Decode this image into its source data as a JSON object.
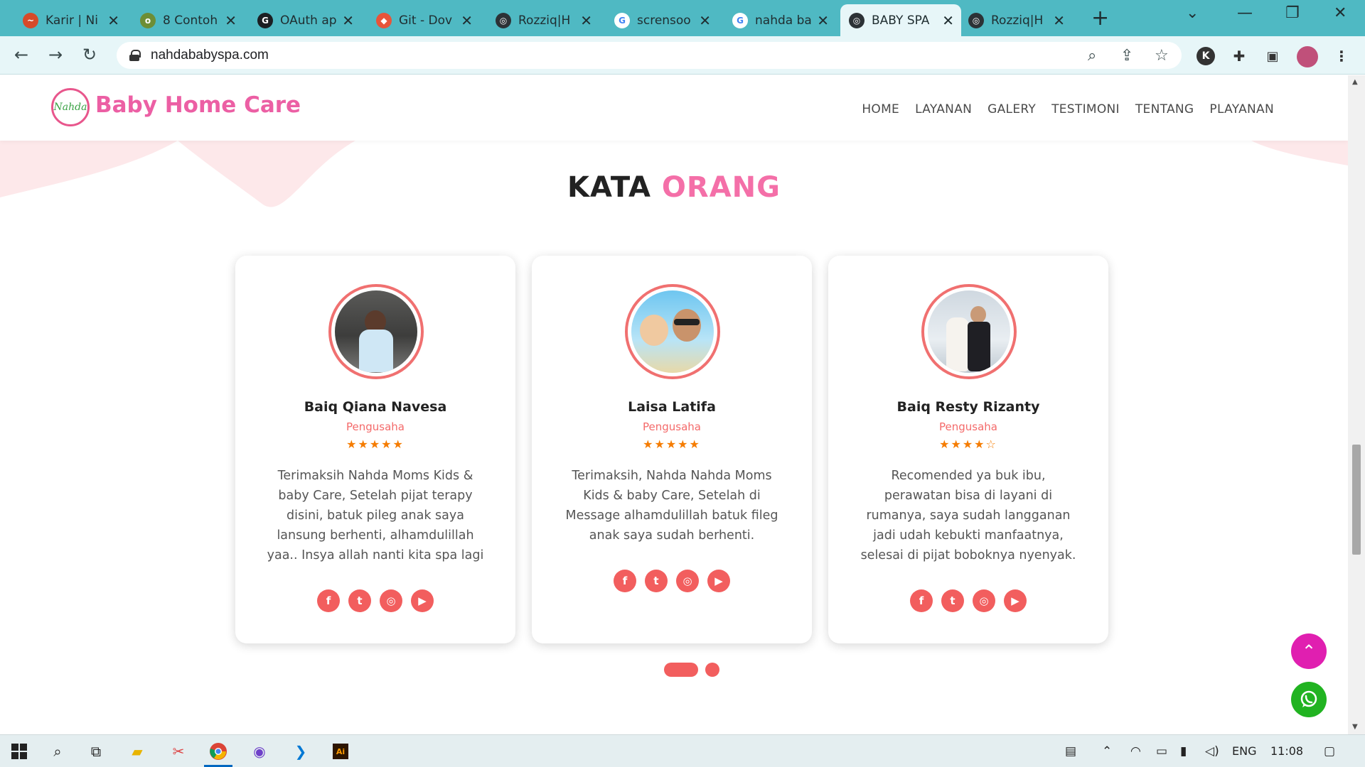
{
  "browser": {
    "tabs": [
      {
        "title": "Karir | Ni",
        "color": "#d64a2a",
        "glyph": "~"
      },
      {
        "title": "8 Contoh",
        "color": "#6d8e36",
        "glyph": "o"
      },
      {
        "title": "OAuth ap",
        "color": "#1b1f23",
        "glyph": "G"
      },
      {
        "title": "Git - Dov",
        "color": "#e8543a",
        "glyph": "◆"
      },
      {
        "title": "Rozziq|H",
        "color": "#2c3236",
        "glyph": "◎"
      },
      {
        "title": "scrensoo",
        "color": "#ffffff",
        "glyph": "G"
      },
      {
        "title": "nahda ba",
        "color": "#ffffff",
        "glyph": "G"
      },
      {
        "title": "BABY SPA",
        "color": "#2c3236",
        "glyph": "◎"
      },
      {
        "title": "Rozziq|H",
        "color": "#2c3236",
        "glyph": "◎"
      }
    ],
    "active_tab_index": 7,
    "url": "nahdababyspa.com"
  },
  "site": {
    "logo_mark": "Nahda",
    "brand": "Baby Home Care",
    "menu": [
      "HOME",
      "LAYANAN",
      "GALERY",
      "TESTIMONI",
      "TENTANG",
      "PLAYANAN"
    ]
  },
  "section": {
    "title_part1": "KATA",
    "title_part2": "ORANG"
  },
  "testimonials": [
    {
      "name": "Baiq Qiana Navesa",
      "role": "Pengusaha",
      "rating": 5,
      "stars": "★★★★★",
      "quote": "Terimaksih Nahda Moms Kids & baby Care, Setelah pijat terapy disini, batuk pileg anak saya lansung berhenti, alhamdulillah yaa.. Insya allah nanti kita spa lagi"
    },
    {
      "name": "Laisa Latifa",
      "role": "Pengusaha",
      "rating": 5,
      "stars": "★★★★★",
      "quote": "Terimaksih, Nahda Nahda Moms Kids & baby Care, Setelah di Message alhamdulillah batuk fileg anak saya sudah berhenti."
    },
    {
      "name": "Baiq Resty Rizanty",
      "role": "Pengusaha",
      "rating": 4,
      "stars": "★★★★☆",
      "quote": "Recomended ya buk ibu, perawatan bisa di layani di rumanya, saya sudah langganan jadi udah kebukti manfaatnya, selesai di pijat boboknya nyenyak."
    }
  ],
  "social_icons": [
    "facebook-icon",
    "twitter-icon",
    "instagram-icon",
    "youtube-icon"
  ],
  "carousel": {
    "pages": 2,
    "active": 0
  },
  "taskbar": {
    "lang": "ENG",
    "time": "11:08"
  },
  "colors": {
    "brand_pink": "#ec5fa4",
    "accent_red": "#f25e5e",
    "browser_teal": "#4fb9c3",
    "scroll_top_fab": "#e01fb0",
    "whatsapp": "#21b321"
  }
}
